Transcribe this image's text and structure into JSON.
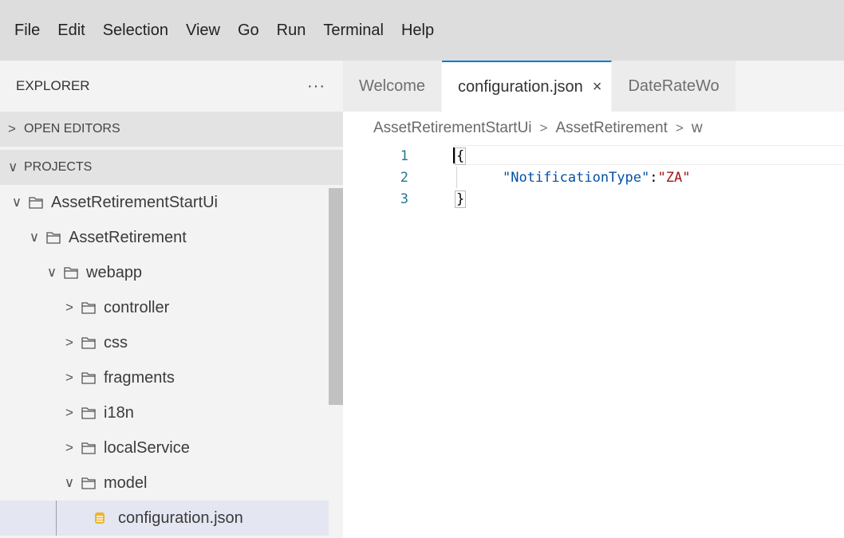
{
  "menubar": {
    "items": [
      "File",
      "Edit",
      "Selection",
      "View",
      "Go",
      "Run",
      "Terminal",
      "Help"
    ]
  },
  "sidebar": {
    "title": "EXPLORER",
    "more": "···",
    "sections": {
      "open_editors": "OPEN EDITORS",
      "projects": "PROJECTS"
    },
    "tree": [
      {
        "label": "AssetRetirementStartUi",
        "expanded": true,
        "type": "folder"
      },
      {
        "label": "AssetRetirement",
        "expanded": true,
        "type": "folder"
      },
      {
        "label": "webapp",
        "expanded": true,
        "type": "folder"
      },
      {
        "label": "controller",
        "expanded": false,
        "type": "folder"
      },
      {
        "label": "css",
        "expanded": false,
        "type": "folder"
      },
      {
        "label": "fragments",
        "expanded": false,
        "type": "folder"
      },
      {
        "label": "i18n",
        "expanded": false,
        "type": "folder"
      },
      {
        "label": "localService",
        "expanded": false,
        "type": "folder"
      },
      {
        "label": "model",
        "expanded": true,
        "type": "folder"
      },
      {
        "label": "configuration.json",
        "type": "file",
        "selected": true
      }
    ]
  },
  "editor": {
    "tabs": [
      {
        "label": "Welcome",
        "active": false
      },
      {
        "label": "configuration.json",
        "active": true,
        "close": "×"
      },
      {
        "label": "DateRateWo",
        "active": false
      }
    ],
    "breadcrumb": [
      "AssetRetirementStartUi",
      "AssetRetirement",
      "w"
    ],
    "breadcrumb_sep": ">",
    "lines": [
      {
        "no": "1",
        "open": "{"
      },
      {
        "no": "2",
        "key": "\"NotificationType\"",
        "colon": ":",
        "value": "\"ZA\""
      },
      {
        "no": "3",
        "close": "}"
      }
    ]
  },
  "colors": {
    "accent": "#007acc",
    "json_key": "#0451a5",
    "json_string": "#a31515",
    "line_number": "#237893",
    "selection": "#e4e6f1"
  }
}
